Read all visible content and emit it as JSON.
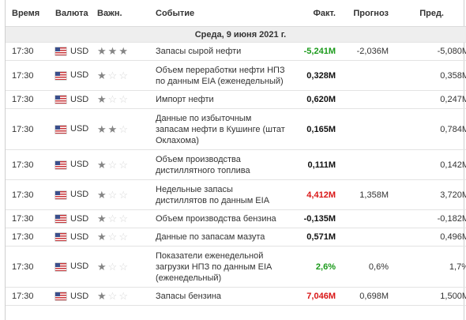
{
  "headers": {
    "time": "Время",
    "currency": "Валюта",
    "importance": "Важн.",
    "event": "Событие",
    "actual": "Факт.",
    "forecast": "Прогноз",
    "previous": "Пред."
  },
  "date_label": "Среда, 9 июня 2021 г.",
  "colors": {
    "positive": "#1a9a1a",
    "negative": "#d91616",
    "neutral": "#111111",
    "date_bg": "#eeeeee"
  },
  "rows": [
    {
      "time": "17:30",
      "currency": "USD",
      "importance": 3,
      "event": "Запасы сырой нефти",
      "actual": "-5,241M",
      "actual_color": "positive",
      "forecast": "-2,036M",
      "previous": "-5,080M"
    },
    {
      "time": "17:30",
      "currency": "USD",
      "importance": 1,
      "event": "Объем переработки нефти НПЗ по данным EIA (еженедельный)",
      "actual": "0,328M",
      "actual_color": "neutral",
      "forecast": "",
      "previous": "0,358M"
    },
    {
      "time": "17:30",
      "currency": "USD",
      "importance": 1,
      "event": "Импорт нефти",
      "actual": "0,620M",
      "actual_color": "neutral",
      "forecast": "",
      "previous": "0,247M"
    },
    {
      "time": "17:30",
      "currency": "USD",
      "importance": 2,
      "event": "Данные по избыточным запасам нефти в Кушинге (штат Оклахома)",
      "actual": "0,165M",
      "actual_color": "neutral",
      "forecast": "",
      "previous": "0,784M"
    },
    {
      "time": "17:30",
      "currency": "USD",
      "importance": 1,
      "event": "Объем производства дистиллятного топлива",
      "actual": "0,111M",
      "actual_color": "neutral",
      "forecast": "",
      "previous": "0,142M"
    },
    {
      "time": "17:30",
      "currency": "USD",
      "importance": 1,
      "event": "Недельные запасы дистиллятов по данным EIA",
      "actual": "4,412M",
      "actual_color": "negative",
      "forecast": "1,358M",
      "previous": "3,720M"
    },
    {
      "time": "17:30",
      "currency": "USD",
      "importance": 1,
      "event": "Объем производства бензина",
      "actual": "-0,135M",
      "actual_color": "neutral",
      "forecast": "",
      "previous": "-0,182M"
    },
    {
      "time": "17:30",
      "currency": "USD",
      "importance": 1,
      "event": "Данные по запасам мазута",
      "actual": "0,571M",
      "actual_color": "neutral",
      "forecast": "",
      "previous": "0,496M"
    },
    {
      "time": "17:30",
      "currency": "USD",
      "importance": 1,
      "event": "Показатели еженедельной загрузки НПЗ по данным EIA (еженедельный)",
      "actual": "2,6%",
      "actual_color": "positive",
      "forecast": "0,6%",
      "previous": "1,7%"
    },
    {
      "time": "17:30",
      "currency": "USD",
      "importance": 1,
      "event": "Запасы бензина",
      "actual": "7,046M",
      "actual_color": "negative",
      "forecast": "0,698M",
      "previous": "1,500M"
    }
  ]
}
